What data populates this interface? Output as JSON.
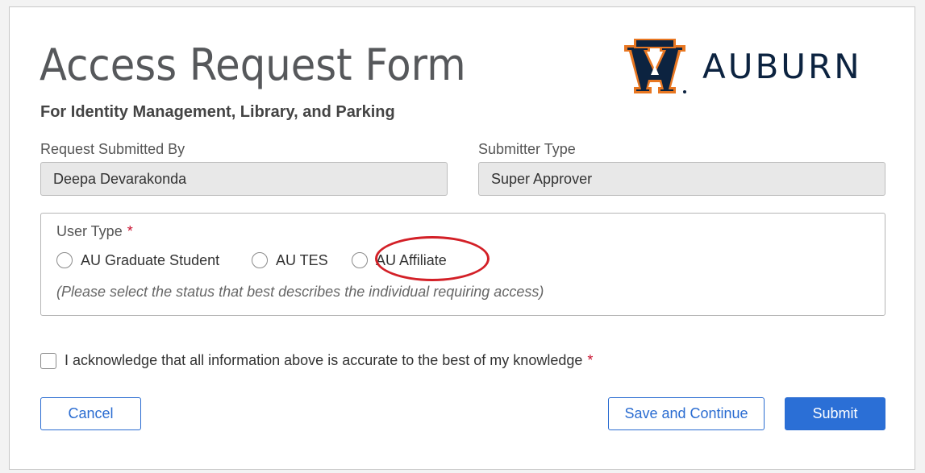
{
  "form": {
    "title": "Access Request Form",
    "subtitle": "For Identity Management, Library, and Parking"
  },
  "logo": {
    "text": "AUBURN",
    "icon": "auburn-au-logo-icon",
    "colors": {
      "navy": "#0c2340",
      "orange": "#e87722"
    }
  },
  "fields": {
    "submitted_by": {
      "label": "Request Submitted By",
      "value": "Deepa Devarakonda"
    },
    "submitter_type": {
      "label": "Submitter Type",
      "value": "Super Approver"
    }
  },
  "user_type": {
    "label": "User Type",
    "required_marker": "*",
    "options": [
      {
        "label": "AU Graduate Student",
        "selected": false
      },
      {
        "label": "AU TES",
        "selected": false
      },
      {
        "label": "AU Affiliate",
        "selected": false,
        "highlighted": true
      }
    ],
    "hint": "(Please select the status that best describes the individual requiring access)"
  },
  "acknowledge": {
    "label": "I acknowledge that all information above is accurate to the best of my knowledge",
    "required_marker": "*",
    "checked": false
  },
  "buttons": {
    "cancel": "Cancel",
    "save_continue": "Save and Continue",
    "submit": "Submit"
  },
  "colors": {
    "accent": "#2b6fd6",
    "required": "#c8102e",
    "highlight": "#d32027"
  }
}
